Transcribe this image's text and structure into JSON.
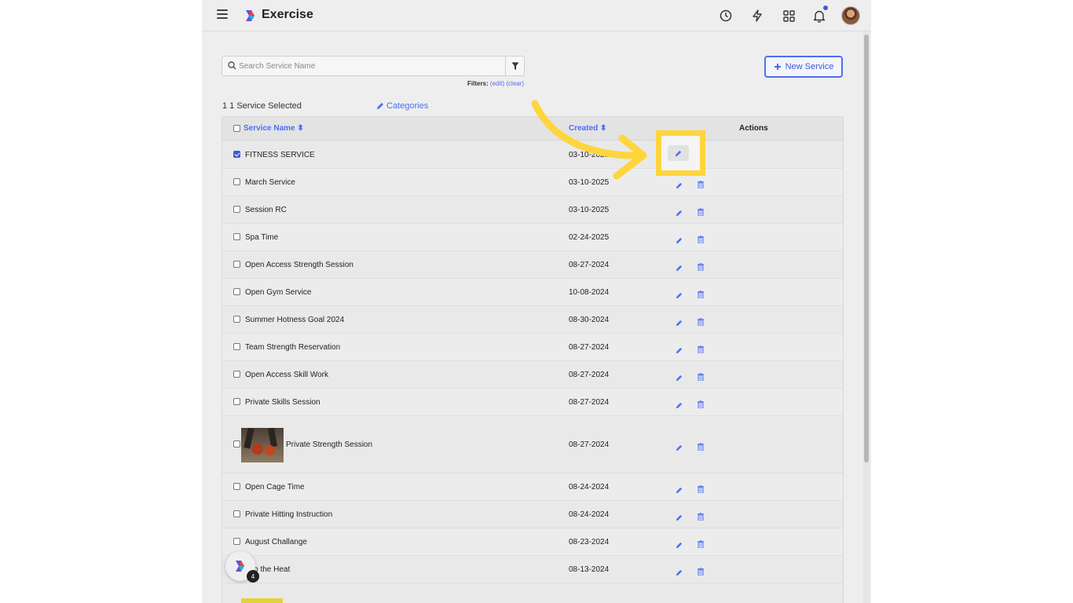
{
  "app": {
    "title": "Exercise"
  },
  "topbar": {
    "icons": [
      "history-icon",
      "lightning-icon",
      "grid-icon",
      "bell-icon"
    ]
  },
  "search": {
    "placeholder": "Search Service Name",
    "value": ""
  },
  "filters": {
    "label": "Filters:",
    "edit": "(edit)",
    "clear": "(clear)"
  },
  "toolbar": {
    "new_service_label": "New Service",
    "selected_count": "1 1 Service Selected",
    "categories_label": "Categories"
  },
  "table": {
    "columns": {
      "name": "Service Name",
      "created": "Created",
      "actions": "Actions"
    },
    "rows": [
      {
        "name": "FITNESS SERVICE",
        "created": "03-10-2025",
        "checked": true
      },
      {
        "name": "March Service",
        "created": "03-10-2025",
        "checked": false
      },
      {
        "name": "Session RC",
        "created": "03-10-2025",
        "checked": false
      },
      {
        "name": "Spa Time",
        "created": "02-24-2025",
        "checked": false
      },
      {
        "name": "Open Access Strength Session",
        "created": "08-27-2024",
        "checked": false
      },
      {
        "name": "Open Gym Service",
        "created": "10-08-2024",
        "checked": false
      },
      {
        "name": "Summer Hotness Goal 2024",
        "created": "08-30-2024",
        "checked": false
      },
      {
        "name": "Team Strength Reservation",
        "created": "08-27-2024",
        "checked": false
      },
      {
        "name": "Open Access Skill Work",
        "created": "08-27-2024",
        "checked": false
      },
      {
        "name": "Private Skills Session",
        "created": "08-27-2024",
        "checked": false
      },
      {
        "name": "Private Strength Session",
        "created": "08-27-2024",
        "checked": false,
        "has_image": true
      },
      {
        "name": "Open Cage Time",
        "created": "08-24-2024",
        "checked": false
      },
      {
        "name": "Private Hitting Instruction",
        "created": "08-24-2024",
        "checked": false
      },
      {
        "name": "August Challange",
        "created": "08-23-2024",
        "checked": false
      },
      {
        "name": "Into the Heat",
        "created": "08-13-2024",
        "checked": false
      }
    ]
  },
  "chat": {
    "badge_count": "4"
  },
  "colors": {
    "accent": "#4c6ef5",
    "highlight": "#ffd53d",
    "arrow": "#ffd53d"
  }
}
